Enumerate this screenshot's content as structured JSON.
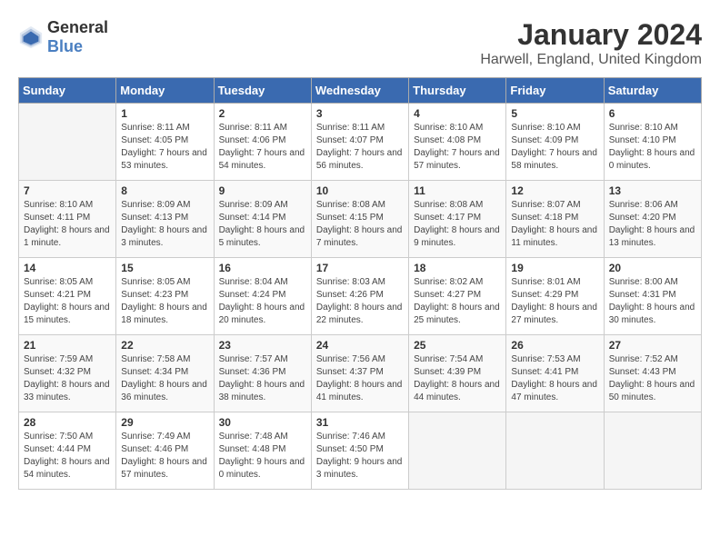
{
  "header": {
    "logo_general": "General",
    "logo_blue": "Blue",
    "month": "January 2024",
    "location": "Harwell, England, United Kingdom"
  },
  "days_of_week": [
    "Sunday",
    "Monday",
    "Tuesday",
    "Wednesday",
    "Thursday",
    "Friday",
    "Saturday"
  ],
  "weeks": [
    [
      {
        "day": "",
        "sunrise": "",
        "sunset": "",
        "daylight": ""
      },
      {
        "day": "1",
        "sunrise": "Sunrise: 8:11 AM",
        "sunset": "Sunset: 4:05 PM",
        "daylight": "Daylight: 7 hours and 53 minutes."
      },
      {
        "day": "2",
        "sunrise": "Sunrise: 8:11 AM",
        "sunset": "Sunset: 4:06 PM",
        "daylight": "Daylight: 7 hours and 54 minutes."
      },
      {
        "day": "3",
        "sunrise": "Sunrise: 8:11 AM",
        "sunset": "Sunset: 4:07 PM",
        "daylight": "Daylight: 7 hours and 56 minutes."
      },
      {
        "day": "4",
        "sunrise": "Sunrise: 8:10 AM",
        "sunset": "Sunset: 4:08 PM",
        "daylight": "Daylight: 7 hours and 57 minutes."
      },
      {
        "day": "5",
        "sunrise": "Sunrise: 8:10 AM",
        "sunset": "Sunset: 4:09 PM",
        "daylight": "Daylight: 7 hours and 58 minutes."
      },
      {
        "day": "6",
        "sunrise": "Sunrise: 8:10 AM",
        "sunset": "Sunset: 4:10 PM",
        "daylight": "Daylight: 8 hours and 0 minutes."
      }
    ],
    [
      {
        "day": "7",
        "sunrise": "Sunrise: 8:10 AM",
        "sunset": "Sunset: 4:11 PM",
        "daylight": "Daylight: 8 hours and 1 minute."
      },
      {
        "day": "8",
        "sunrise": "Sunrise: 8:09 AM",
        "sunset": "Sunset: 4:13 PM",
        "daylight": "Daylight: 8 hours and 3 minutes."
      },
      {
        "day": "9",
        "sunrise": "Sunrise: 8:09 AM",
        "sunset": "Sunset: 4:14 PM",
        "daylight": "Daylight: 8 hours and 5 minutes."
      },
      {
        "day": "10",
        "sunrise": "Sunrise: 8:08 AM",
        "sunset": "Sunset: 4:15 PM",
        "daylight": "Daylight: 8 hours and 7 minutes."
      },
      {
        "day": "11",
        "sunrise": "Sunrise: 8:08 AM",
        "sunset": "Sunset: 4:17 PM",
        "daylight": "Daylight: 8 hours and 9 minutes."
      },
      {
        "day": "12",
        "sunrise": "Sunrise: 8:07 AM",
        "sunset": "Sunset: 4:18 PM",
        "daylight": "Daylight: 8 hours and 11 minutes."
      },
      {
        "day": "13",
        "sunrise": "Sunrise: 8:06 AM",
        "sunset": "Sunset: 4:20 PM",
        "daylight": "Daylight: 8 hours and 13 minutes."
      }
    ],
    [
      {
        "day": "14",
        "sunrise": "Sunrise: 8:05 AM",
        "sunset": "Sunset: 4:21 PM",
        "daylight": "Daylight: 8 hours and 15 minutes."
      },
      {
        "day": "15",
        "sunrise": "Sunrise: 8:05 AM",
        "sunset": "Sunset: 4:23 PM",
        "daylight": "Daylight: 8 hours and 18 minutes."
      },
      {
        "day": "16",
        "sunrise": "Sunrise: 8:04 AM",
        "sunset": "Sunset: 4:24 PM",
        "daylight": "Daylight: 8 hours and 20 minutes."
      },
      {
        "day": "17",
        "sunrise": "Sunrise: 8:03 AM",
        "sunset": "Sunset: 4:26 PM",
        "daylight": "Daylight: 8 hours and 22 minutes."
      },
      {
        "day": "18",
        "sunrise": "Sunrise: 8:02 AM",
        "sunset": "Sunset: 4:27 PM",
        "daylight": "Daylight: 8 hours and 25 minutes."
      },
      {
        "day": "19",
        "sunrise": "Sunrise: 8:01 AM",
        "sunset": "Sunset: 4:29 PM",
        "daylight": "Daylight: 8 hours and 27 minutes."
      },
      {
        "day": "20",
        "sunrise": "Sunrise: 8:00 AM",
        "sunset": "Sunset: 4:31 PM",
        "daylight": "Daylight: 8 hours and 30 minutes."
      }
    ],
    [
      {
        "day": "21",
        "sunrise": "Sunrise: 7:59 AM",
        "sunset": "Sunset: 4:32 PM",
        "daylight": "Daylight: 8 hours and 33 minutes."
      },
      {
        "day": "22",
        "sunrise": "Sunrise: 7:58 AM",
        "sunset": "Sunset: 4:34 PM",
        "daylight": "Daylight: 8 hours and 36 minutes."
      },
      {
        "day": "23",
        "sunrise": "Sunrise: 7:57 AM",
        "sunset": "Sunset: 4:36 PM",
        "daylight": "Daylight: 8 hours and 38 minutes."
      },
      {
        "day": "24",
        "sunrise": "Sunrise: 7:56 AM",
        "sunset": "Sunset: 4:37 PM",
        "daylight": "Daylight: 8 hours and 41 minutes."
      },
      {
        "day": "25",
        "sunrise": "Sunrise: 7:54 AM",
        "sunset": "Sunset: 4:39 PM",
        "daylight": "Daylight: 8 hours and 44 minutes."
      },
      {
        "day": "26",
        "sunrise": "Sunrise: 7:53 AM",
        "sunset": "Sunset: 4:41 PM",
        "daylight": "Daylight: 8 hours and 47 minutes."
      },
      {
        "day": "27",
        "sunrise": "Sunrise: 7:52 AM",
        "sunset": "Sunset: 4:43 PM",
        "daylight": "Daylight: 8 hours and 50 minutes."
      }
    ],
    [
      {
        "day": "28",
        "sunrise": "Sunrise: 7:50 AM",
        "sunset": "Sunset: 4:44 PM",
        "daylight": "Daylight: 8 hours and 54 minutes."
      },
      {
        "day": "29",
        "sunrise": "Sunrise: 7:49 AM",
        "sunset": "Sunset: 4:46 PM",
        "daylight": "Daylight: 8 hours and 57 minutes."
      },
      {
        "day": "30",
        "sunrise": "Sunrise: 7:48 AM",
        "sunset": "Sunset: 4:48 PM",
        "daylight": "Daylight: 9 hours and 0 minutes."
      },
      {
        "day": "31",
        "sunrise": "Sunrise: 7:46 AM",
        "sunset": "Sunset: 4:50 PM",
        "daylight": "Daylight: 9 hours and 3 minutes."
      },
      {
        "day": "",
        "sunrise": "",
        "sunset": "",
        "daylight": ""
      },
      {
        "day": "",
        "sunrise": "",
        "sunset": "",
        "daylight": ""
      },
      {
        "day": "",
        "sunrise": "",
        "sunset": "",
        "daylight": ""
      }
    ]
  ]
}
